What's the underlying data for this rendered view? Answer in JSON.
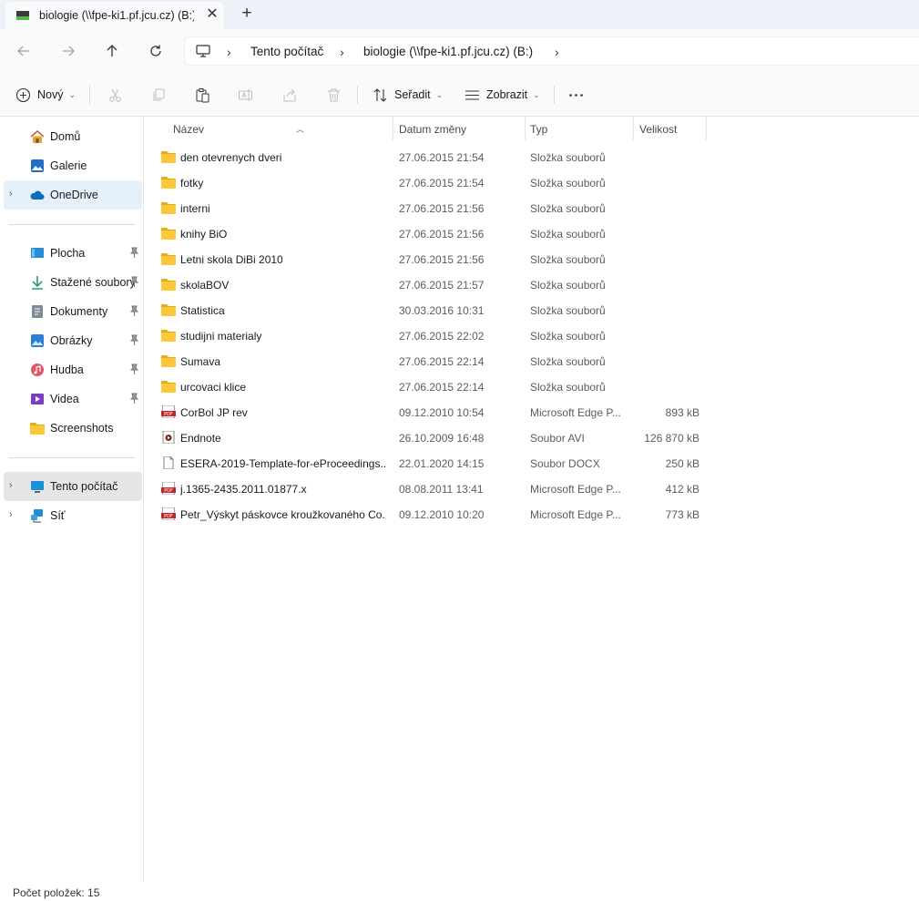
{
  "tab": {
    "title": "biologie (\\\\fpe-ki1.pf.jcu.cz) (B:)"
  },
  "address": {
    "segments": [
      "Tento počítač",
      "biologie (\\\\fpe-ki1.pf.jcu.cz) (B:)"
    ]
  },
  "toolbar": {
    "new_label": "Nový",
    "sort_label": "Seřadit",
    "view_label": "Zobrazit"
  },
  "sidebar": {
    "top": [
      {
        "label": "Domů",
        "icon": "home-icon"
      },
      {
        "label": "Galerie",
        "icon": "gallery-icon"
      },
      {
        "label": "OneDrive",
        "icon": "cloud-icon"
      }
    ],
    "pinned": [
      {
        "label": "Plocha",
        "icon": "desktop-icon"
      },
      {
        "label": "Stažené soubory",
        "icon": "download-icon"
      },
      {
        "label": "Dokumenty",
        "icon": "document-icon"
      },
      {
        "label": "Obrázky",
        "icon": "pictures-icon"
      },
      {
        "label": "Hudba",
        "icon": "music-icon"
      },
      {
        "label": "Videa",
        "icon": "video-icon"
      },
      {
        "label": "Screenshots",
        "icon": "folder-icon"
      }
    ],
    "bottom": [
      {
        "label": "Tento počítač",
        "icon": "computer-icon"
      },
      {
        "label": "Síť",
        "icon": "network-icon"
      }
    ]
  },
  "columns": {
    "name": "Název",
    "date": "Datum změny",
    "type": "Typ",
    "size": "Velikost"
  },
  "files": [
    {
      "name": "den otevrenych dveri",
      "date": "27.06.2015 21:54",
      "type": "Složka souborů",
      "size": "",
      "icon": "folder-icon"
    },
    {
      "name": "fotky",
      "date": "27.06.2015 21:54",
      "type": "Složka souborů",
      "size": "",
      "icon": "folder-icon"
    },
    {
      "name": "interni",
      "date": "27.06.2015 21:56",
      "type": "Složka souborů",
      "size": "",
      "icon": "folder-icon"
    },
    {
      "name": "knihy BiO",
      "date": "27.06.2015 21:56",
      "type": "Složka souborů",
      "size": "",
      "icon": "folder-icon"
    },
    {
      "name": "Letni skola DiBi 2010",
      "date": "27.06.2015 21:56",
      "type": "Složka souborů",
      "size": "",
      "icon": "folder-icon"
    },
    {
      "name": "skolaBOV",
      "date": "27.06.2015 21:57",
      "type": "Složka souborů",
      "size": "",
      "icon": "folder-icon"
    },
    {
      "name": "Statistica",
      "date": "30.03.2016 10:31",
      "type": "Složka souborů",
      "size": "",
      "icon": "folder-icon"
    },
    {
      "name": "studijni materialy",
      "date": "27.06.2015 22:02",
      "type": "Složka souborů",
      "size": "",
      "icon": "folder-icon"
    },
    {
      "name": "Sumava",
      "date": "27.06.2015 22:14",
      "type": "Složka souborů",
      "size": "",
      "icon": "folder-icon"
    },
    {
      "name": "urcovaci klice",
      "date": "27.06.2015 22:14",
      "type": "Složka souborů",
      "size": "",
      "icon": "folder-icon"
    },
    {
      "name": "CorBol JP rev",
      "date": "09.12.2010 10:54",
      "type": "Microsoft Edge P...",
      "size": "893 kB",
      "icon": "pdf-icon"
    },
    {
      "name": "Endnote",
      "date": "26.10.2009 16:48",
      "type": "Soubor AVI",
      "size": "126 870 kB",
      "icon": "video-file-icon"
    },
    {
      "name": "ESERA-2019-Template-for-eProceedings....",
      "date": "22.01.2020 14:15",
      "type": "Soubor DOCX",
      "size": "250 kB",
      "icon": "blank-file-icon"
    },
    {
      "name": "j.1365-2435.2011.01877.x",
      "date": "08.08.2011 13:41",
      "type": "Microsoft Edge P...",
      "size": "412 kB",
      "icon": "pdf-icon"
    },
    {
      "name": "Petr_Výskyt páskovce kroužkovaného Co...",
      "date": "09.12.2010 10:20",
      "type": "Microsoft Edge P...",
      "size": "773 kB",
      "icon": "pdf-icon"
    }
  ],
  "status": {
    "text": "Počet položek: 15"
  }
}
